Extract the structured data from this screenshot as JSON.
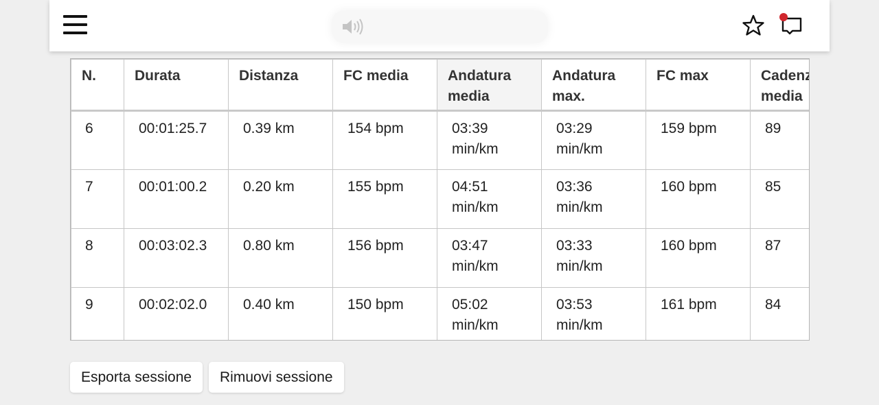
{
  "header": {
    "menu_icon": "hamburger-menu-icon",
    "audio_icon": "speaker-icon",
    "bookmark_icon": "star-icon",
    "cast_icon": "cast-icon",
    "notification_dot_color": "#d0262d"
  },
  "table": {
    "columns": [
      "N.",
      "Durata",
      "Distanza",
      "FC media",
      "Andatura media",
      "Andatura max.",
      "FC max",
      "Cadenza media"
    ],
    "rows": [
      [
        "6",
        "00:01:25.7",
        "0.39 km",
        "154 bpm",
        "03:39 min/km",
        "03:29 min/km",
        "159 bpm",
        "89"
      ],
      [
        "7",
        "00:01:00.2",
        "0.20 km",
        "155 bpm",
        "04:51 min/km",
        "03:36 min/km",
        "160 bpm",
        "85"
      ],
      [
        "8",
        "00:03:02.3",
        "0.80 km",
        "156 bpm",
        "03:47 min/km",
        "03:33 min/km",
        "160 bpm",
        "87"
      ],
      [
        "9",
        "00:02:02.0",
        "0.40 km",
        "150 bpm",
        "05:02 min/km",
        "03:53 min/km",
        "161 bpm",
        "84"
      ]
    ]
  },
  "actions": {
    "export_label": "Esporta sessione",
    "remove_label": "Rimuovi sessione"
  }
}
